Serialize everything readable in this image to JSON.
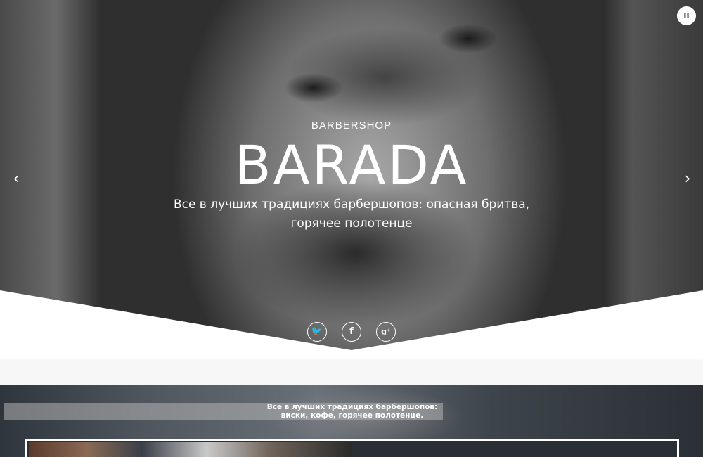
{
  "hero": {
    "kicker": "BARBERSHOP",
    "title": "BARADA",
    "subtitle": "Все в лучших традициях барбершопов: опасная бритва, горячее полотенце",
    "prev_icon": "chevron-left-icon",
    "prev_glyph": "‹",
    "next_icon": "chevron-right-icon",
    "next_glyph": "›",
    "pause_icon": "pause-icon",
    "pause_glyph": "II"
  },
  "socials": [
    {
      "name": "twitter-icon",
      "glyph": "🐦"
    },
    {
      "name": "facebook-icon",
      "glyph": "f"
    },
    {
      "name": "google-plus-icon",
      "glyph": "g⁺"
    }
  ],
  "section2": {
    "tagline_line1": "Все в лучших традициях барбершопов:",
    "tagline_line2": "виски, кофе, горячее полотенце."
  },
  "colors": {
    "text_on_dark": "#ffffff",
    "band": "#f7f7f7"
  }
}
